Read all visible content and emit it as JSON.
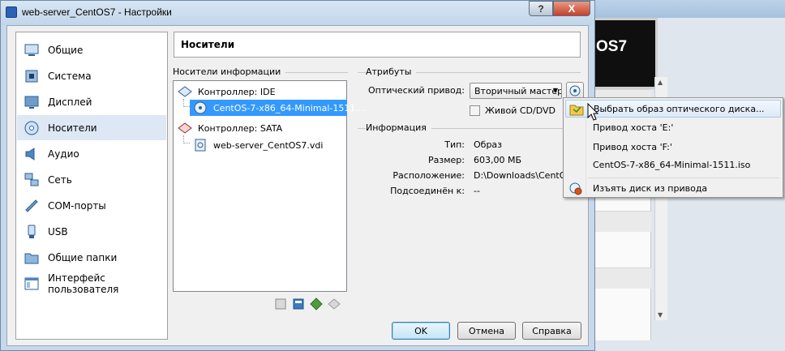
{
  "background_window": {
    "preview_text": "OS7"
  },
  "dialog": {
    "title": "web-server_CentOS7 - Настройки",
    "help_label": "?",
    "close_label": "X"
  },
  "categories": [
    {
      "label": "Общие",
      "icon": "general-icon"
    },
    {
      "label": "Система",
      "icon": "system-icon"
    },
    {
      "label": "Дисплей",
      "icon": "display-icon"
    },
    {
      "label": "Носители",
      "icon": "storage-icon",
      "selected": true
    },
    {
      "label": "Аудио",
      "icon": "audio-icon"
    },
    {
      "label": "Сеть",
      "icon": "network-icon"
    },
    {
      "label": "COM-порты",
      "icon": "serial-ports-icon"
    },
    {
      "label": "USB",
      "icon": "usb-icon"
    },
    {
      "label": "Общие папки",
      "icon": "shared-folders-icon"
    },
    {
      "label": "Интерфейс пользователя",
      "icon": "user-interface-icon"
    }
  ],
  "page": {
    "title": "Носители"
  },
  "storage": {
    "label": "Носители информации",
    "tree": [
      {
        "label": "Контроллер: IDE",
        "type": "controller"
      },
      {
        "label": "CentOS-7-x86_64-Minimal-1511....",
        "type": "optical",
        "selected": true
      },
      {
        "label": "Контроллер: SATA",
        "type": "controller"
      },
      {
        "label": "web-server_CentOS7.vdi",
        "type": "disk"
      }
    ]
  },
  "attributes": {
    "label": "Атрибуты",
    "optical_drive_label": "Оптический привод:",
    "optical_drive_value": "Вторичный мастер",
    "live_cd_label": "Живой CD/DVD"
  },
  "information": {
    "label": "Информация",
    "rows": [
      {
        "key": "Тип:",
        "value": "Образ"
      },
      {
        "key": "Размер:",
        "value": "603,00 МБ"
      },
      {
        "key": "Расположение:",
        "value": "D:\\Downloads\\CentOS-"
      },
      {
        "key": "Подсоединён к:",
        "value": "--"
      }
    ]
  },
  "buttons": {
    "ok": "OK",
    "cancel": "Отмена",
    "help": "Справка"
  },
  "menu": {
    "items": [
      {
        "label": "Выбрать образ оптического диска...",
        "icon": "folder-icon"
      },
      {
        "label": "Привод хоста 'E:'"
      },
      {
        "label": "Привод хоста 'F:'"
      },
      {
        "label": "CentOS-7-x86_64-Minimal-1511.iso"
      },
      {
        "label": "Изъять диск из привода",
        "icon": "eject-disc-icon"
      }
    ]
  },
  "colors": {
    "selection": "#3399ff",
    "title_bar": "#c2d5ea",
    "close_button": "#c5412b"
  }
}
